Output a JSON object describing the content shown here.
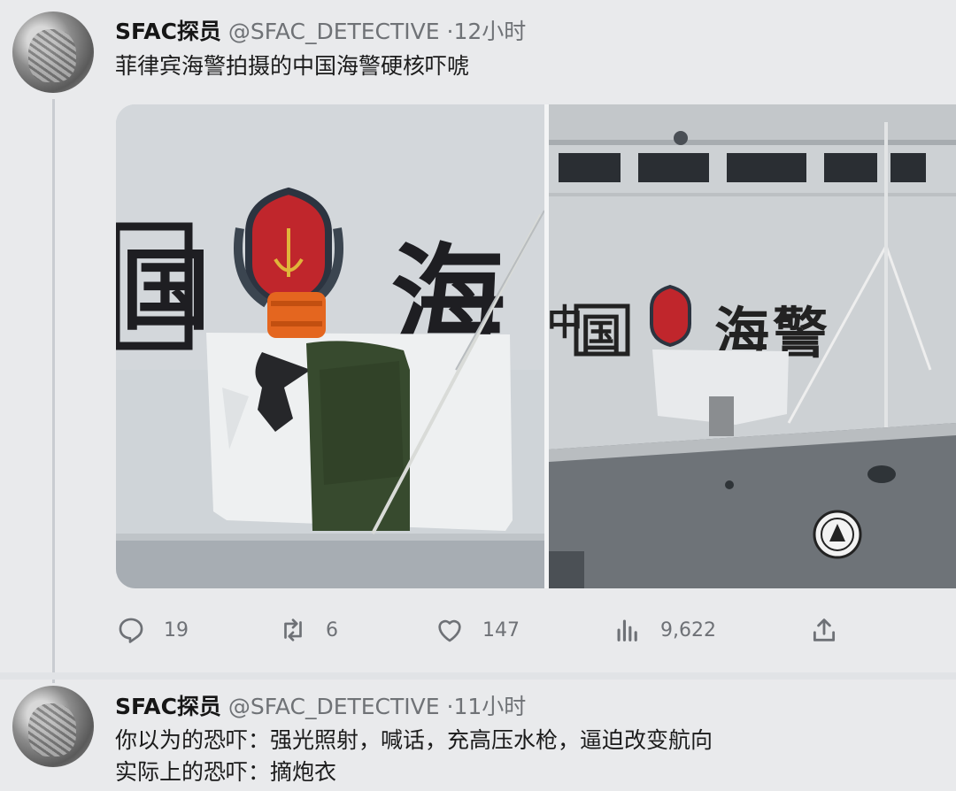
{
  "tweet1": {
    "name": "SFAC探员",
    "handle": "@SFAC_DETECTIVE",
    "dot": "·",
    "time": "12小时",
    "text": "菲律宾海警拍摄的中国海警硬核吓唬",
    "media": {
      "left_hull_text": [
        "国",
        "海"
      ],
      "right_hull_text": [
        "中",
        "国",
        "海",
        "警"
      ]
    },
    "actions": {
      "reply_count": "19",
      "retweet_count": "6",
      "like_count": "147",
      "views_count": "9,622"
    }
  },
  "tweet2": {
    "name": "SFAC探员",
    "handle": "@SFAC_DETECTIVE",
    "dot": "·",
    "time": "11小时",
    "line1": "你以为的恐吓：强光照射，喊话，充高压水枪，逼迫改变航向",
    "line2": "实际上的恐吓：摘炮衣"
  },
  "colors": {
    "background": "#e9eaec",
    "text": "#141414",
    "muted": "#6f7276",
    "emblem_red": "#c0262c",
    "life_vest": "#e4661f"
  },
  "icons": [
    "reply-icon",
    "retweet-icon",
    "like-icon",
    "views-icon",
    "share-icon"
  ]
}
